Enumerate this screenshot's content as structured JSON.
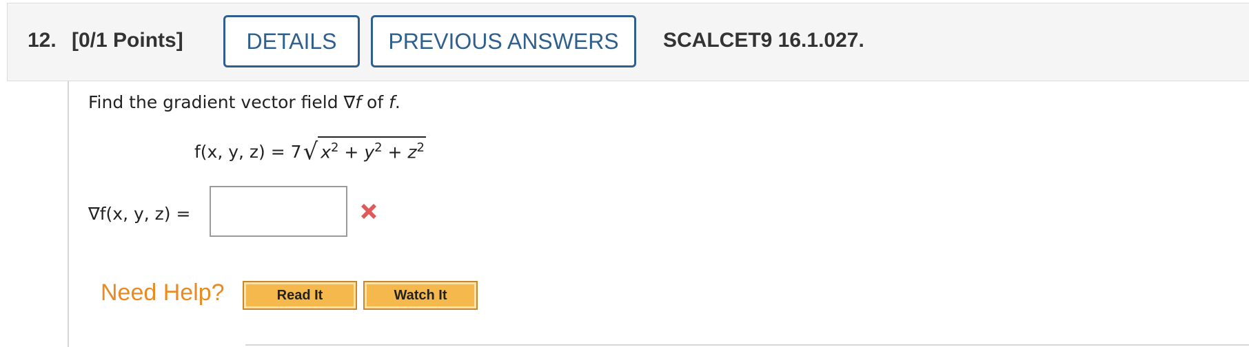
{
  "header": {
    "question_number": "12.",
    "points": "[0/1 Points]",
    "details_label": "DETAILS",
    "previous_answers_label": "PREVIOUS ANSWERS",
    "question_id": "SCALCET9 16.1.027."
  },
  "question": {
    "prompt_prefix": "Find the gradient vector field ∇",
    "prompt_f1": "f",
    "prompt_mid": " of ",
    "prompt_f2": "f",
    "prompt_suffix": ".",
    "function_lhs": "f(x, y, z) = 7",
    "radicand_x": "x",
    "radicand_y": "y",
    "radicand_z": "z",
    "exponent": "2",
    "plus": " + "
  },
  "answer": {
    "label": "∇f(x, y, z) =",
    "value": "",
    "status_icon": "incorrect-x-icon",
    "status_color": "#e05a5a"
  },
  "help": {
    "label": "Need Help?",
    "read_it": "Read It",
    "watch_it": "Watch It"
  }
}
